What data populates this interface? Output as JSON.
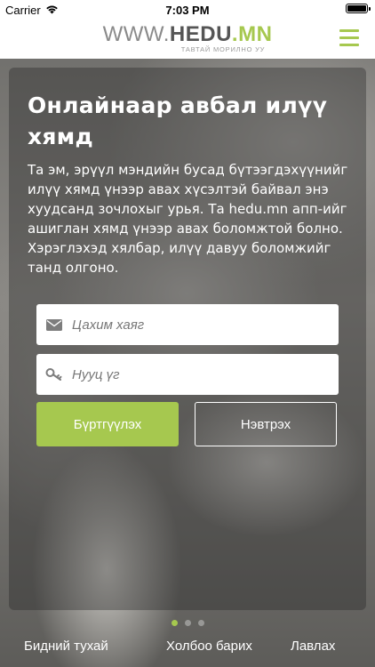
{
  "status_bar": {
    "carrier": "Carrier",
    "time": "7:03 PM",
    "icons": [
      "wifi-icon",
      "battery-icon"
    ]
  },
  "header": {
    "logo_prefix": "WWW.",
    "logo_brand": "HEDU",
    "logo_tld": ".MN",
    "tagline": "ТАВТАЙ МОРИЛНО УУ",
    "menu_icon": "hamburger-menu-icon",
    "accent_color": "#a6c84f"
  },
  "main": {
    "title": "Онлайнаар авбал илүү хямд",
    "description": "Та эм, эрүүл мэндийн бусад бүтээгдэхүүнийг илүү хямд үнээр авах хүсэлтэй байвал энэ хуудсанд зочлохыг урья. Та hedu.mn апп-ийг ашиглан хямд үнээр авах боломжтой болно. Хэрэглэхэд хялбар, илүү давуу боломжийг танд олгоно.",
    "email": {
      "placeholder": "Цахим хаяг",
      "value": "",
      "icon": "envelope-icon"
    },
    "password": {
      "placeholder": "Нууц үг",
      "value": "",
      "icon": "key-icon"
    },
    "register_label": "Бүртгүүлэх",
    "login_label": "Нэвтрэх"
  },
  "pager": {
    "count": 3,
    "active": 1
  },
  "footer": {
    "about": "Бидний тухай",
    "contact": "Холбоо барих",
    "faq": "Лавлах"
  }
}
